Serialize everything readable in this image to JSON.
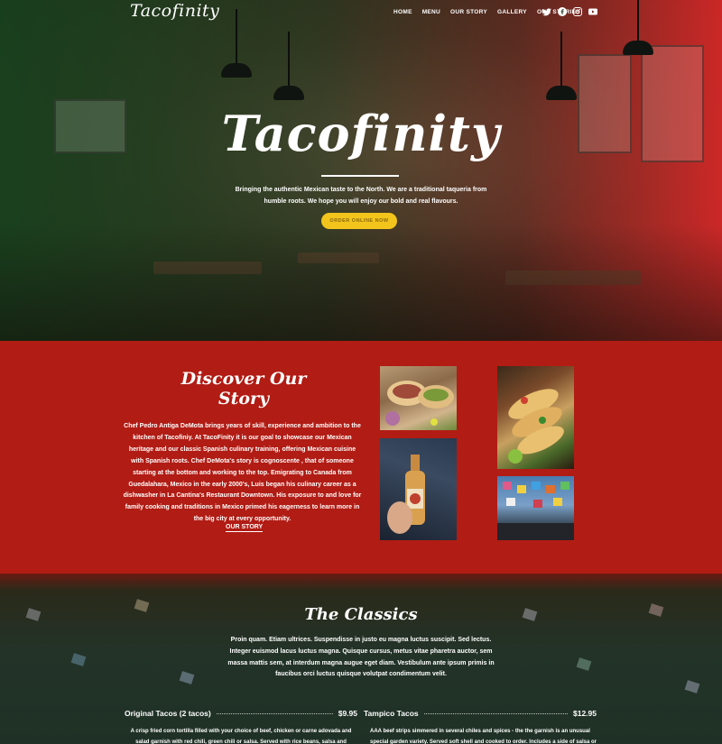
{
  "nav": {
    "logo": "Tacofinity",
    "links": [
      "HOME",
      "MENU",
      "OUR STORY",
      "GALLERY",
      "OUR STORIES"
    ],
    "social": [
      "twitter-icon",
      "facebook-icon",
      "instagram-icon",
      "youtube-icon"
    ]
  },
  "hero": {
    "title": "Tacofinity",
    "subtitle": "Bringing the authentic Mexican taste to the North. We are a traditional taqueria from humble roots. We hope you will enjoy our bold and real flavours.",
    "cta": "ORDER ONLINE NOW"
  },
  "story": {
    "title": "Discover Our Story",
    "text": "Chef Pedro Antiga DeMota brings years of skill, experience and ambition to the kitchen of Tacofiniy. At TacoFinity it is our goal to showcase our Mexican heritage and our classic Spanish culinary training, offering Mexican cuisine with Spanish roots. Chef DeMota's story is cognoscente , that of someone starting at the bottom and working to the top. Emigrating to Canada from Guedalahara, Mexico in the early 2000's, Luis began his culinary career as a dishwasher in La Cantina's Restaurant Downtown. His exposure to and love for family cooking and traditions in Mexico primed his eagerness to learn more in the big city at every opportunity.",
    "link": "OUR STORY"
  },
  "classics": {
    "title": "The Classics",
    "text": "Proin quam. Etiam ultrices. Suspendisse in justo eu magna luctus suscipit. Sed lectus. Integer euismod lacus luctus magna. Quisque cursus, metus vitae pharetra auctor, sem massa mattis sem, at interdum magna augue eget diam. Vestibulum ante ipsum primis in faucibus orci luctus quisque volutpat condimentum velit.",
    "items": [
      {
        "name": "Original Tacos (2 tacos)",
        "price": "$9.95",
        "desc": "A crisp fried corn tortilla filled with your choice of beef, chicken or carne adovada and salad garnish with red chili, green chili or salsa. Served with rice beans, salsa and guacamole"
      },
      {
        "name": "Tampico Tacos",
        "price": "$12.95",
        "desc": "AAA beef strips simmered in several chiles and spices - the the garnish is an unusual special garden variety. Served soft shell and cooked to order. Includes a side of salsa or chile sauce."
      }
    ]
  },
  "colors": {
    "story_bg": "#b11c14",
    "cta": "#f3c41b",
    "hero_left": "#16461e",
    "hero_right": "#e12828"
  }
}
